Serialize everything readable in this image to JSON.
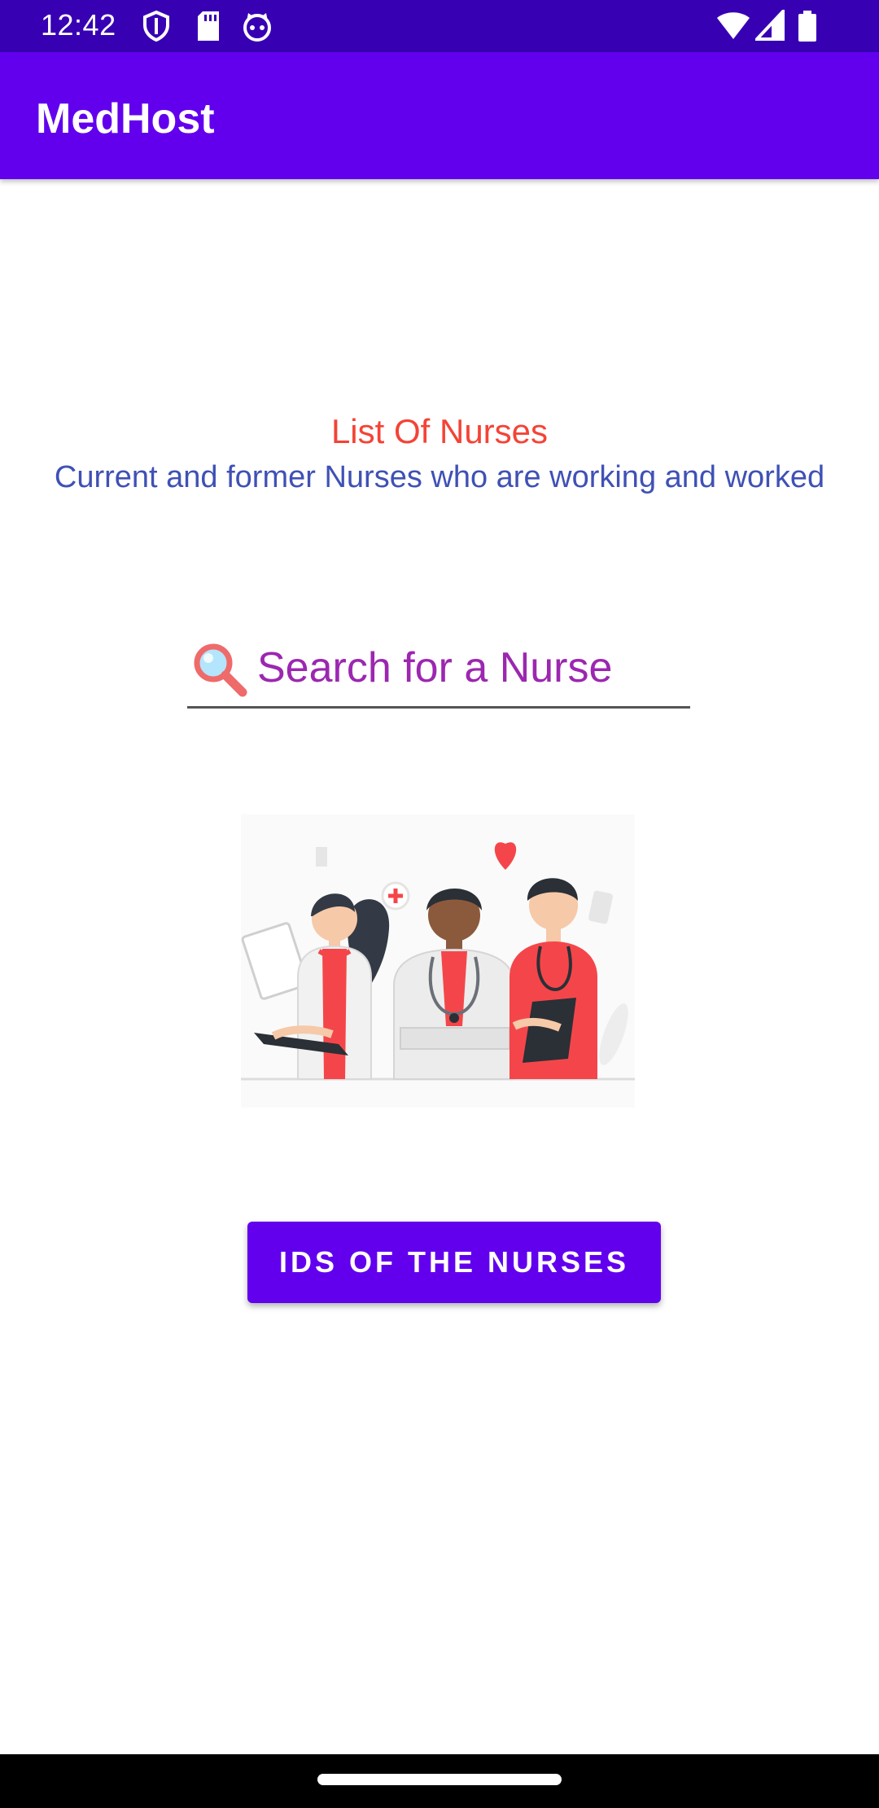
{
  "status_bar": {
    "time": "12:42",
    "left_icons": [
      "shield-icon",
      "sd-card-icon",
      "cat-face-icon"
    ],
    "right_icons": [
      "wifi-icon",
      "cell-signal-icon",
      "battery-icon"
    ],
    "background": "#3700b3"
  },
  "app_bar": {
    "title": "MedHost",
    "background": "#6200ee"
  },
  "main": {
    "title": "List Of Nurses",
    "title_color": "#f44336",
    "subtitle": "Current and former Nurses who are working and worked",
    "subtitle_color": "#3f51b5",
    "search": {
      "placeholder": "Search for a Nurse",
      "value": "",
      "icon": "magnifier-icon",
      "text_color": "#9c27b0"
    },
    "illustration": "nurses-illustration",
    "button": {
      "label": "IDS OF THE NURSES",
      "background": "#6200ee"
    }
  },
  "nav_bar": {
    "handle": "home-handle"
  }
}
